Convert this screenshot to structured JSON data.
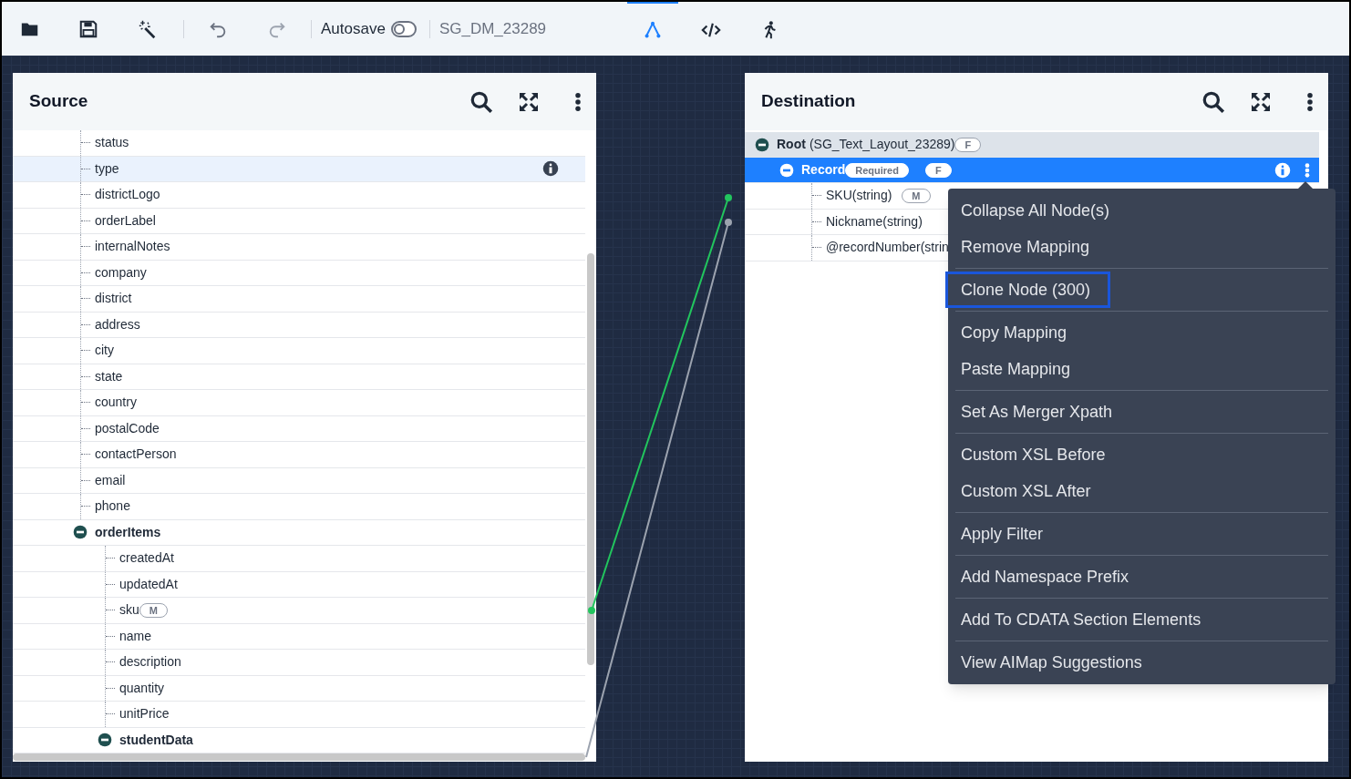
{
  "toolbar": {
    "autosave": {
      "label": "Autosave",
      "on": false
    },
    "document_name": "SG_DM_23289",
    "undo_disabled": true,
    "redo_disabled": true,
    "view_tabs": [
      {
        "kind": "mapping",
        "selected": true
      },
      {
        "kind": "code",
        "selected": false
      },
      {
        "kind": "run",
        "selected": false
      }
    ]
  },
  "source": {
    "title": "Source",
    "rows": [
      {
        "label": "status",
        "selected": false
      },
      {
        "label": "type",
        "selected": true
      },
      {
        "label": "districtLogo",
        "selected": false
      },
      {
        "label": "orderLabel",
        "selected": false
      },
      {
        "label": "internalNotes",
        "selected": false
      },
      {
        "label": "company",
        "selected": false
      },
      {
        "label": "district",
        "selected": false
      },
      {
        "label": "address",
        "selected": false
      },
      {
        "label": "city",
        "selected": false
      },
      {
        "label": "state",
        "selected": false
      },
      {
        "label": "country",
        "selected": false
      },
      {
        "label": "postalCode",
        "selected": false
      },
      {
        "label": "contactPerson",
        "selected": false
      },
      {
        "label": "email",
        "selected": false
      },
      {
        "label": "phone",
        "selected": false
      },
      {
        "label": "orderItems",
        "selected": false,
        "expanded": true,
        "children": [
          {
            "label": "createdAt",
            "selected": false
          },
          {
            "label": "updatedAt",
            "selected": false
          },
          {
            "label": "sku",
            "selected": false,
            "badges": [
              "M"
            ]
          },
          {
            "label": "name",
            "selected": false
          },
          {
            "label": "description",
            "selected": false
          },
          {
            "label": "quantity",
            "selected": false
          },
          {
            "label": "unitPrice",
            "selected": false
          },
          {
            "label": "studentData",
            "selected": false,
            "expanded": true
          }
        ]
      }
    ]
  },
  "destination": {
    "title": "Destination",
    "rows": [
      {
        "label": "Root",
        "detail": "(SG_Text_Layout_23289)",
        "badges": [
          "F"
        ],
        "selected": false,
        "expanded": true,
        "children": [
          {
            "label": "Record",
            "badges": [
              "Required",
              "F"
            ],
            "selected": true,
            "expanded": true,
            "children": [
              {
                "label": "SKU(string)",
                "badges": [
                  "M"
                ],
                "selected": false
              },
              {
                "label": "Nickname(string)",
                "selected": false
              },
              {
                "label": "@recordNumber(strin",
                "selected": false
              }
            ]
          }
        ]
      }
    ]
  },
  "context_menu": {
    "groups": [
      [
        {
          "label": "Collapse All Node(s)",
          "focused": false
        },
        {
          "label": "Remove Mapping",
          "focused": false
        }
      ],
      [
        {
          "label": "Clone Node (300)",
          "focused": true
        }
      ],
      [
        {
          "label": "Copy Mapping",
          "focused": false
        },
        {
          "label": "Paste Mapping",
          "focused": false
        }
      ],
      [
        {
          "label": "Set As Merger Xpath",
          "focused": false
        }
      ],
      [
        {
          "label": "Custom XSL Before",
          "focused": false
        },
        {
          "label": "Custom XSL After",
          "focused": false
        }
      ],
      [
        {
          "label": "Apply Filter",
          "focused": false
        }
      ],
      [
        {
          "label": "Add Namespace Prefix",
          "focused": false
        }
      ],
      [
        {
          "label": "Add To CDATA Section Elements",
          "focused": false
        }
      ],
      [
        {
          "label": "View AIMap Suggestions",
          "focused": false
        }
      ]
    ]
  },
  "mappings": [
    {
      "kind": "active"
    },
    {
      "kind": "inactive"
    }
  ]
}
